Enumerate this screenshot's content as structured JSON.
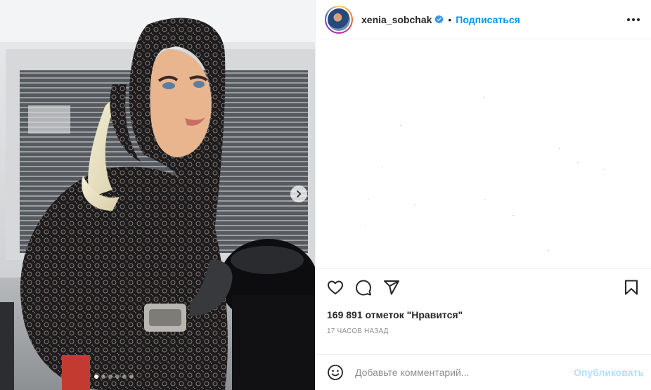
{
  "post": {
    "username": "xenia_sobchak",
    "verified": true,
    "separator": "•",
    "follow_label": "Подписаться",
    "more_icon": "more-horizontal-icon",
    "likes_text": "169 891 отметок \"Нравится\"",
    "time_text": "17 ЧАСОВ НАЗАД",
    "comment_placeholder": "Добавьте комментарий...",
    "publish_label": "Опубликовать"
  },
  "carousel": {
    "slide_count": 6,
    "active_index": 0
  },
  "icons": {
    "like": "heart-icon",
    "comment": "comment-bubble-icon",
    "share": "paper-plane-icon",
    "save": "bookmark-icon",
    "emoji": "emoji-smile-icon",
    "next": "chevron-right-icon",
    "verified": "verified-badge-icon"
  },
  "colors": {
    "accent": "#0095f6",
    "publish_disabled": "#b2dffc",
    "text": "#262626",
    "secondary_text": "#8e8e8e",
    "border": "#efefef"
  }
}
